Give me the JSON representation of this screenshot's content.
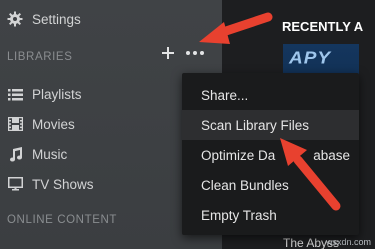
{
  "sidebar": {
    "settings_label": "Settings",
    "libraries_header": "LIBRARIES",
    "items": [
      {
        "label": "Playlists",
        "icon": "list-icon"
      },
      {
        "label": "Movies",
        "icon": "film-icon"
      },
      {
        "label": "Music",
        "icon": "music-note-icon"
      },
      {
        "label": "TV Shows",
        "icon": "monitor-icon"
      }
    ],
    "online_header": "ONLINE CONTENT"
  },
  "main": {
    "section_title": "RECENTLY A",
    "poster_text": "APY",
    "poster_caption": "The Abyss",
    "watermark": "wsxdn.com"
  },
  "menu": {
    "items": [
      {
        "label": "Share..."
      },
      {
        "label": "Scan Library Files"
      },
      {
        "label": "Optimize Da"
      },
      {
        "label": "Clean Bundles"
      },
      {
        "label": "Empty Trash"
      }
    ],
    "optimize_suffix": "abase"
  },
  "colors": {
    "sidebar_bg": "#3f4245",
    "menu_bg": "#1a1b1c",
    "menu_hover": "#2d2e30",
    "arrow": "#e8412f"
  }
}
